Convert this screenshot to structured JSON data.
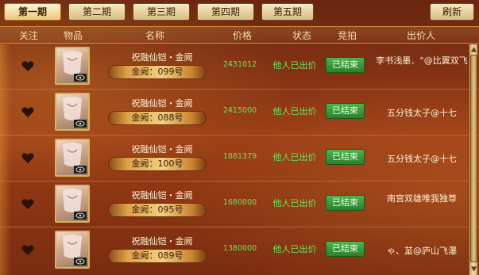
{
  "tabs": [
    {
      "label": "第一期",
      "active": true
    },
    {
      "label": "第二期",
      "active": false
    },
    {
      "label": "第三期",
      "active": false
    },
    {
      "label": "第四期",
      "active": false
    },
    {
      "label": "第五期",
      "active": false
    }
  ],
  "refresh_label": "刷新",
  "headers": {
    "follow": "关注",
    "item": "物品",
    "name": "名称",
    "price": "价格",
    "status": "状态",
    "auction": "竞拍",
    "bidder": "出价人"
  },
  "rows": [
    {
      "name": "祝融仙铠・金阙",
      "plate": "金阙：099号",
      "price": "2431012",
      "status": "他人已出价",
      "bid": "已结束",
      "bidder": "李书浅墨．°@比翼双飞"
    },
    {
      "name": "祝融仙铠・金阙",
      "plate": "金阙：088号",
      "price": "2415000",
      "status": "他人已出价",
      "bid": "已结束",
      "bidder": "五分钱太子@十七"
    },
    {
      "name": "祝融仙铠・金阙",
      "plate": "金阙：100号",
      "price": "1881379",
      "status": "他人已出价",
      "bid": "已结束",
      "bidder": "五分钱太子@十七"
    },
    {
      "name": "祝融仙铠・金阙",
      "plate": "金阙：095号",
      "price": "1680000",
      "status": "他人已出价",
      "bid": "已结束",
      "bidder": "南宫双雄唯我独尊"
    },
    {
      "name": "祝融仙铠・金阙",
      "plate": "金阙：089号",
      "price": "1380000",
      "status": "他人已出价",
      "bid": "已结束",
      "bidder": "ゃ、莁@庐山飞瀑"
    }
  ]
}
